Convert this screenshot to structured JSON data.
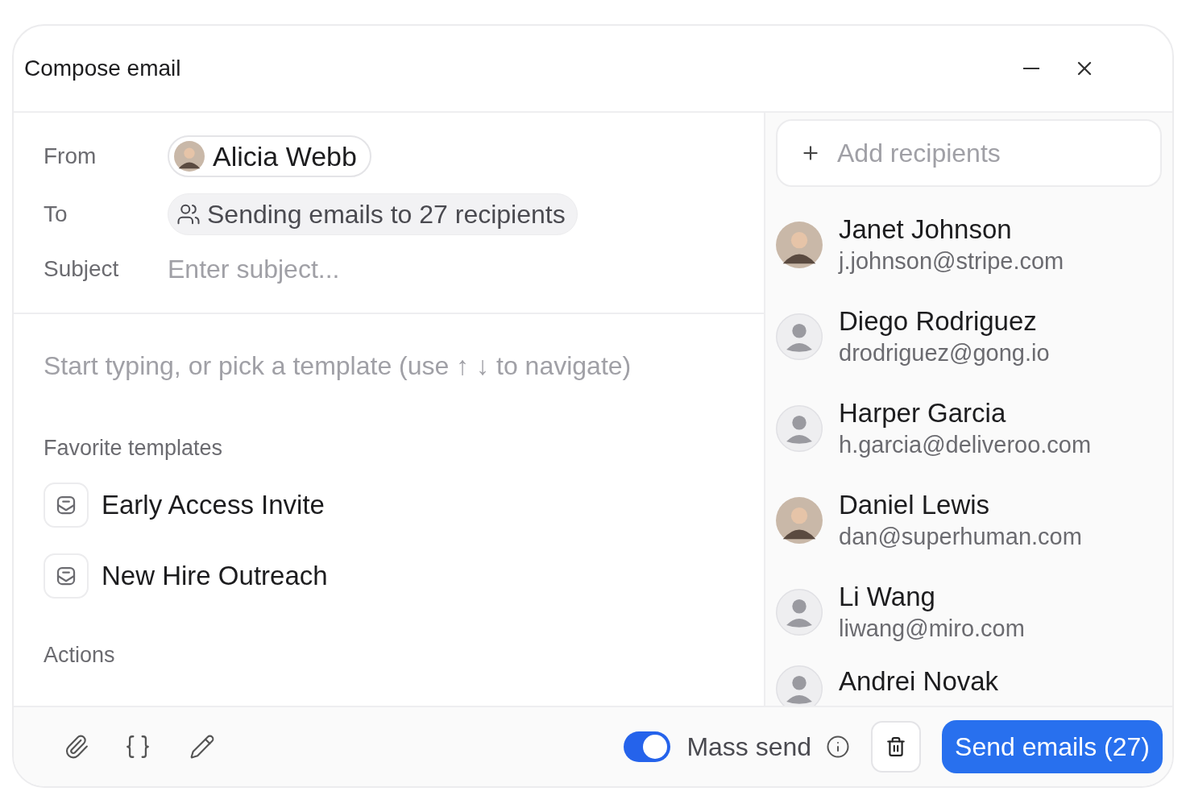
{
  "window": {
    "title": "Compose email"
  },
  "fields": {
    "from_label": "From",
    "from_name": "Alicia Webb",
    "to_label": "To",
    "to_value": "Sending emails to 27 recipients",
    "subject_label": "Subject",
    "subject_placeholder": "Enter subject..."
  },
  "body": {
    "placeholder": "Start typing, or pick a template (use ↑ ↓ to navigate)"
  },
  "favorite_templates": {
    "heading": "Favorite templates",
    "items": [
      "Early Access Invite",
      "New Hire Outreach"
    ]
  },
  "actions": {
    "heading": "Actions"
  },
  "recipients": {
    "add_placeholder": "Add recipients",
    "items": [
      {
        "name": "Janet Johnson",
        "email": "j.johnson@stripe.com"
      },
      {
        "name": "Diego Rodriguez",
        "email": "drodriguez@gong.io",
        "kind": "placeholder"
      },
      {
        "name": "Harper Garcia",
        "email": "h.garcia@deliveroo.com",
        "kind": "placeholder"
      },
      {
        "name": "Daniel Lewis",
        "email": "dan@superhuman.com"
      },
      {
        "name": "Li Wang",
        "email": "liwang@miro.com",
        "kind": "placeholder"
      },
      {
        "name": "Andrei Novak",
        "kind": "placeholder"
      }
    ]
  },
  "footer": {
    "mass_send": {
      "label": "Mass send",
      "on": true
    },
    "send_button": "Send emails (27)"
  }
}
